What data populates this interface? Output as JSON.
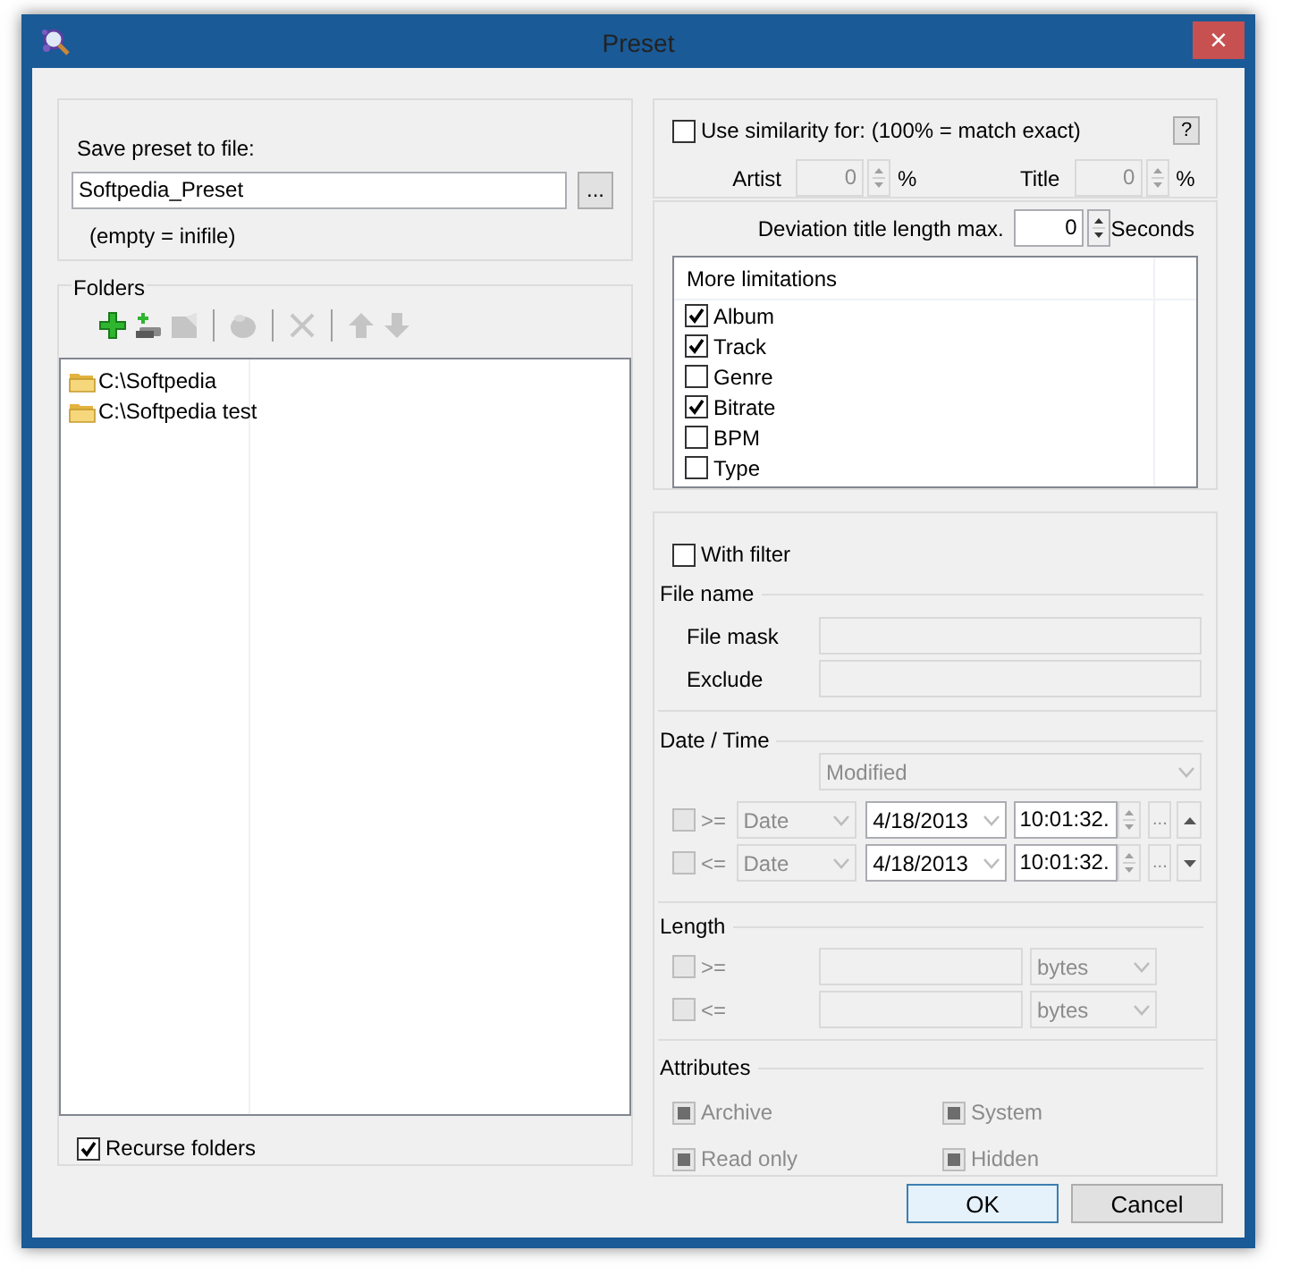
{
  "window": {
    "title": "Preset",
    "close": "×"
  },
  "save": {
    "label": "Save preset to file:",
    "value": "Softpedia_Preset",
    "browse": "...",
    "hint": "(empty = inifile)"
  },
  "folders": {
    "title": "Folders",
    "toolbar": [
      {
        "kind": "add",
        "disabled": false
      },
      {
        "kind": "add-drive",
        "disabled": false
      },
      {
        "kind": "edit",
        "disabled": true
      },
      {
        "kind": "separator"
      },
      {
        "kind": "disk",
        "disabled": true
      },
      {
        "kind": "separator"
      },
      {
        "kind": "delete",
        "disabled": true
      },
      {
        "kind": "separator"
      },
      {
        "kind": "up",
        "disabled": true
      },
      {
        "kind": "down",
        "disabled": true
      }
    ],
    "items": [
      "C:\\Softpedia",
      "C:\\Softpedia test"
    ],
    "recurse": {
      "label": "Recurse folders",
      "checked": true
    }
  },
  "similarity": {
    "label": "Use similarity for: (100% = match exact)",
    "checked": false,
    "help": "?",
    "fields": [
      {
        "label": "Artist",
        "value": "0",
        "unit": "%"
      },
      {
        "label": "Title",
        "value": "0",
        "unit": "%"
      }
    ]
  },
  "deviation": {
    "label": "Deviation title length max.",
    "value": "0",
    "unit": "Seconds"
  },
  "limitations": {
    "title": "More limitations",
    "items": [
      {
        "label": "Album",
        "checked": true
      },
      {
        "label": "Track",
        "checked": true
      },
      {
        "label": "Genre",
        "checked": false
      },
      {
        "label": "Bitrate",
        "checked": true
      },
      {
        "label": "BPM",
        "checked": false
      },
      {
        "label": "Type",
        "checked": false
      }
    ]
  },
  "filter": {
    "label": "With filter",
    "checked": false,
    "file_name": {
      "title": "File name",
      "rows": [
        {
          "label": "File mask"
        },
        {
          "label": "Exclude"
        }
      ]
    },
    "date_time": {
      "title": "Date / Time",
      "mode": "Modified",
      "rows": [
        {
          "op": ">=",
          "kind": "Date",
          "date": "4/18/2013",
          "time": "10:01:32.",
          "browse": "..."
        },
        {
          "op": "<=",
          "kind": "Date",
          "date": "4/18/2013",
          "time": "10:01:32.",
          "browse": "..."
        }
      ]
    },
    "length": {
      "title": "Length",
      "rows": [
        {
          "op": ">=",
          "unit": "bytes"
        },
        {
          "op": "<=",
          "unit": "bytes"
        }
      ]
    },
    "attributes": {
      "title": "Attributes",
      "items": [
        {
          "label": "Archive",
          "indeterminate": true
        },
        {
          "label": "System",
          "indeterminate": true
        },
        {
          "label": "Read only",
          "indeterminate": true
        },
        {
          "label": "Hidden",
          "indeterminate": true
        }
      ]
    }
  },
  "buttons": [
    {
      "label": "OK",
      "default": true
    },
    {
      "label": "Cancel",
      "default": false
    }
  ]
}
